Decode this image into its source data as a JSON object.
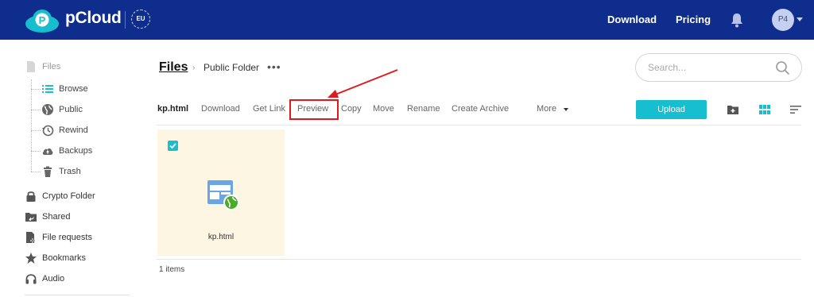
{
  "header": {
    "logo_text": "pCloud",
    "region_badge": "EU",
    "nav": {
      "download": "Download",
      "pricing": "Pricing"
    },
    "avatar_initials": "P4",
    "colors": {
      "bar": "#0f2d8c",
      "accent": "#17bed0"
    }
  },
  "sidebar": {
    "files": "Files",
    "sub_items": [
      {
        "label": "Browse",
        "icon": "list-icon"
      },
      {
        "label": "Public",
        "icon": "globe-icon"
      },
      {
        "label": "Rewind",
        "icon": "rewind-icon"
      },
      {
        "label": "Backups",
        "icon": "cloud-upload-icon"
      },
      {
        "label": "Trash",
        "icon": "trash-icon"
      }
    ],
    "items": [
      {
        "label": "Crypto Folder",
        "icon": "lock-icon"
      },
      {
        "label": "Shared",
        "icon": "shared-folder-icon"
      },
      {
        "label": "File requests",
        "icon": "file-request-icon"
      },
      {
        "label": "Bookmarks",
        "icon": "star-icon"
      },
      {
        "label": "Audio",
        "icon": "headphones-icon"
      }
    ]
  },
  "breadcrumb": {
    "root": "Files",
    "separator": "›",
    "current": "Public Folder",
    "more": "•••"
  },
  "search": {
    "placeholder": "Search..."
  },
  "toolbar": {
    "selected_name": "kp.html",
    "download": "Download",
    "get_link": "Get Link",
    "preview": "Preview",
    "copy": "Copy",
    "move": "Move",
    "rename": "Rename",
    "create_archive": "Create Archive",
    "more": "More",
    "upload": "Upload"
  },
  "files": [
    {
      "name": "kp.html",
      "selected": true,
      "icon": "html-web-file-icon"
    }
  ],
  "status": {
    "items_count": "1 items"
  }
}
